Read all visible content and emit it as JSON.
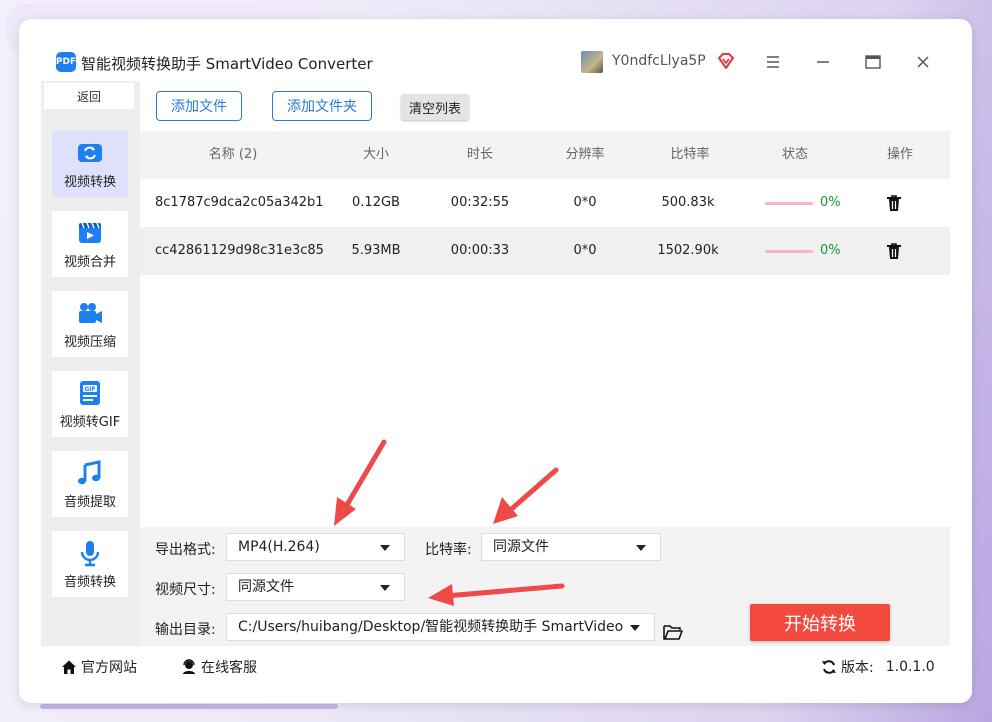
{
  "app": {
    "title": "智能视频转换助手 SmartVideo Converter",
    "logo_text": "PDF",
    "username": "Y0ndfcLlya5P"
  },
  "sidebar": {
    "back_label": "返回",
    "items": [
      {
        "label": "视频转换",
        "icon": "video-convert-icon",
        "active": true
      },
      {
        "label": "视频合并",
        "icon": "video-merge-icon"
      },
      {
        "label": "视频压缩",
        "icon": "video-camera-icon"
      },
      {
        "label": "视频转GIF",
        "icon": "gif-icon"
      },
      {
        "label": "音频提取",
        "icon": "music-note-icon"
      },
      {
        "label": "音频转换",
        "icon": "microphone-icon"
      }
    ]
  },
  "toolbar": {
    "add_file": "添加文件",
    "add_folder": "添加文件夹",
    "clear_list": "清空列表"
  },
  "table": {
    "headers": [
      "名称 (2)",
      "大小",
      "时长",
      "分辨率",
      "比特率",
      "状态",
      "操作"
    ],
    "rows": [
      {
        "name": "8c1787c9dca2c05a342b1...",
        "size": "0.12GB",
        "duration": "00:32:55",
        "resolution": "0*0",
        "bitrate": "500.83k",
        "progress": 0,
        "status": "0%"
      },
      {
        "name": "cc42861129d98c31e3c85...",
        "size": "5.93MB",
        "duration": "00:00:33",
        "resolution": "0*0",
        "bitrate": "1502.90k",
        "progress": 0,
        "status": "0%"
      }
    ]
  },
  "options": {
    "format_label": "导出格式:",
    "format_value": "MP4(H.264)",
    "bitrate_label": "比特率:",
    "bitrate_value": "同源文件",
    "size_label": "视频尺寸:",
    "size_value": "同源文件",
    "output_label": "输出目录:",
    "output_value": "C:/Users/huibang/Desktop/智能视频转换助手 SmartVideo",
    "start_label": "开始转换"
  },
  "footer": {
    "website": "官方网站",
    "support": "在线客服",
    "version_label": "版本:",
    "version": "1.0.1.0"
  },
  "colors": {
    "accent": "#2a7ad9",
    "start": "#f24a3e",
    "status_green": "#1a9a2a",
    "arrow": "#ee4a4a"
  }
}
